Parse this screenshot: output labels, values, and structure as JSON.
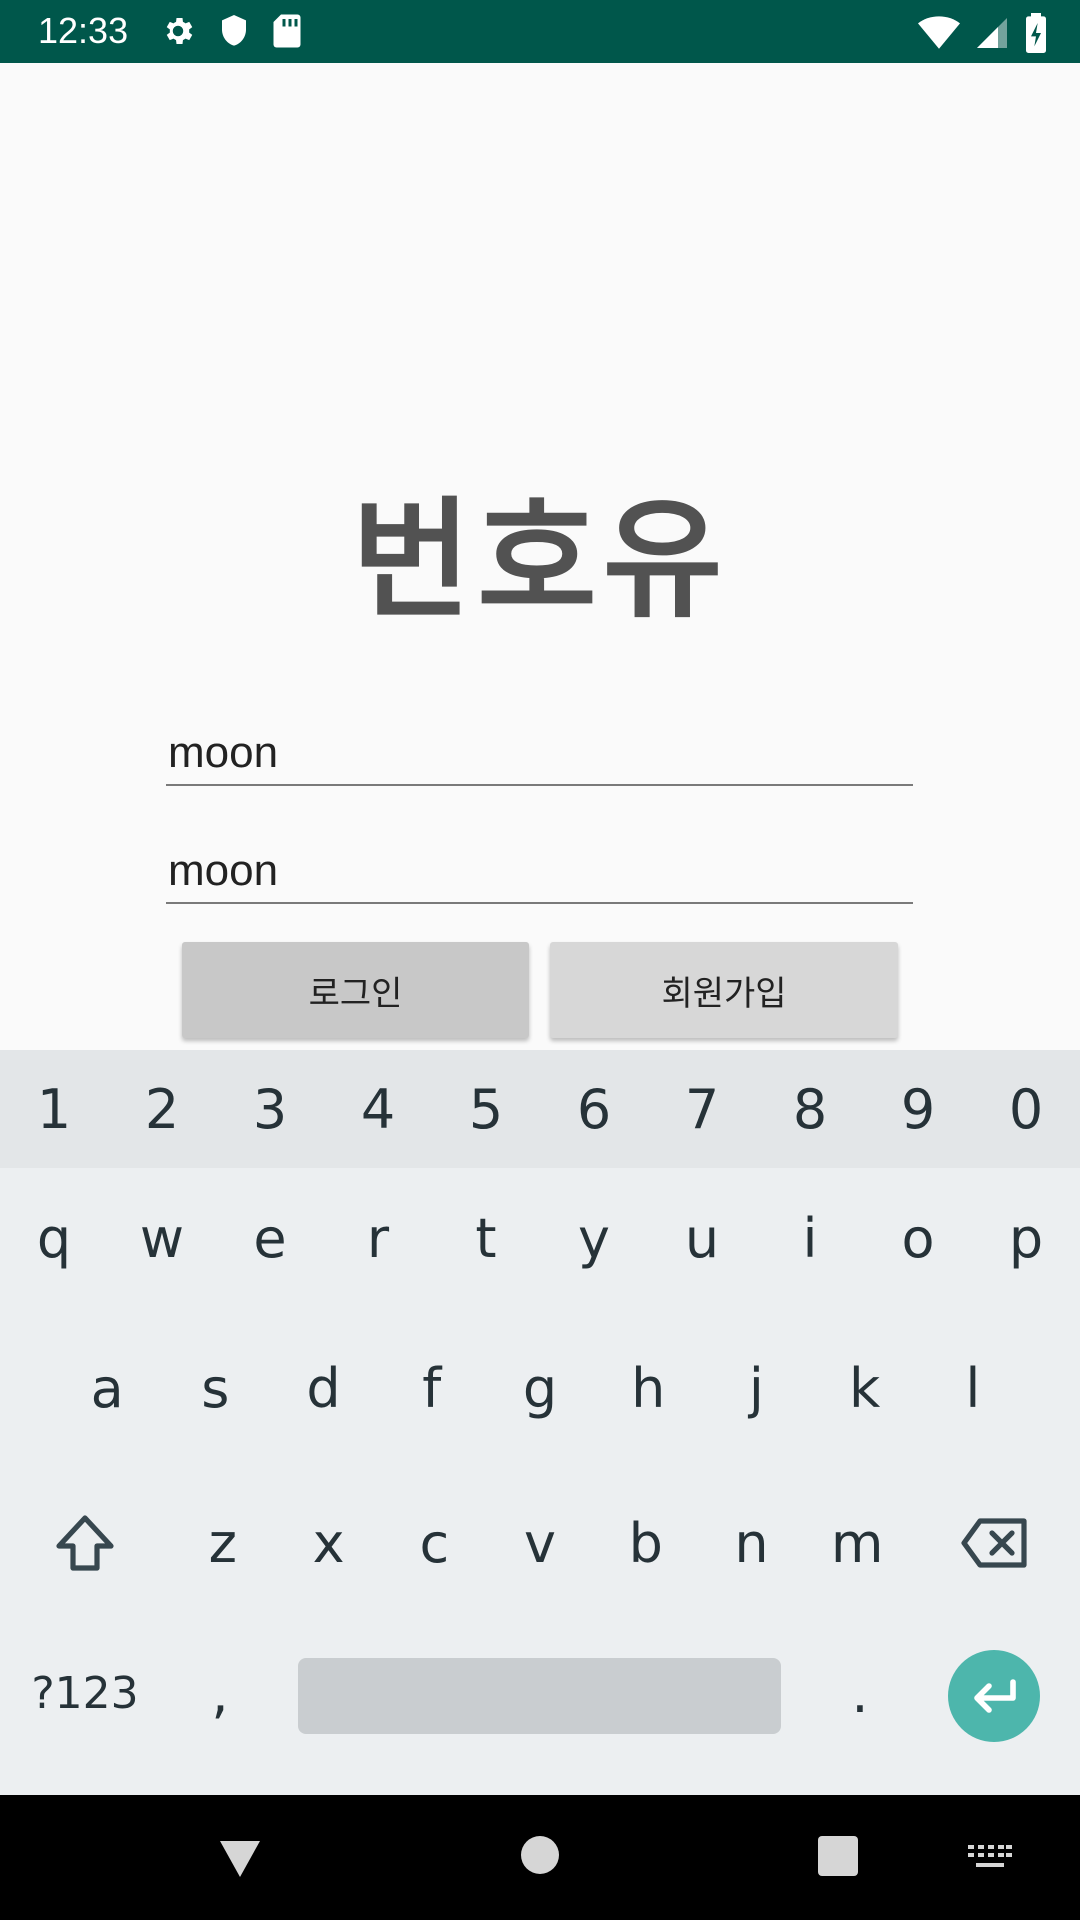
{
  "status_bar": {
    "time": "12:33",
    "left_icons": [
      "gear-icon",
      "shield-icon",
      "sd-card-icon"
    ],
    "right_icons": [
      "wifi-icon",
      "signal-icon",
      "battery-charging-icon"
    ],
    "background": "#00574b"
  },
  "app": {
    "logo_text": "번호유",
    "username_value": "moon",
    "password_value": "moon",
    "login_label": "로그인",
    "signup_label": "회원가입"
  },
  "keyboard": {
    "number_row": [
      "1",
      "2",
      "3",
      "4",
      "5",
      "6",
      "7",
      "8",
      "9",
      "0"
    ],
    "row_q": [
      "q",
      "w",
      "e",
      "r",
      "t",
      "y",
      "u",
      "i",
      "o",
      "p"
    ],
    "row_a": [
      "a",
      "s",
      "d",
      "f",
      "g",
      "h",
      "j",
      "k",
      "l"
    ],
    "row_z": [
      "z",
      "x",
      "c",
      "v",
      "b",
      "n",
      "m"
    ],
    "symbols_label": "?123",
    "comma": ",",
    "period": ".",
    "accent": "#4db6ac"
  },
  "nav_bar": {
    "icons": [
      "back-icon",
      "home-icon",
      "recents-icon",
      "keyboard-switch-icon"
    ]
  }
}
